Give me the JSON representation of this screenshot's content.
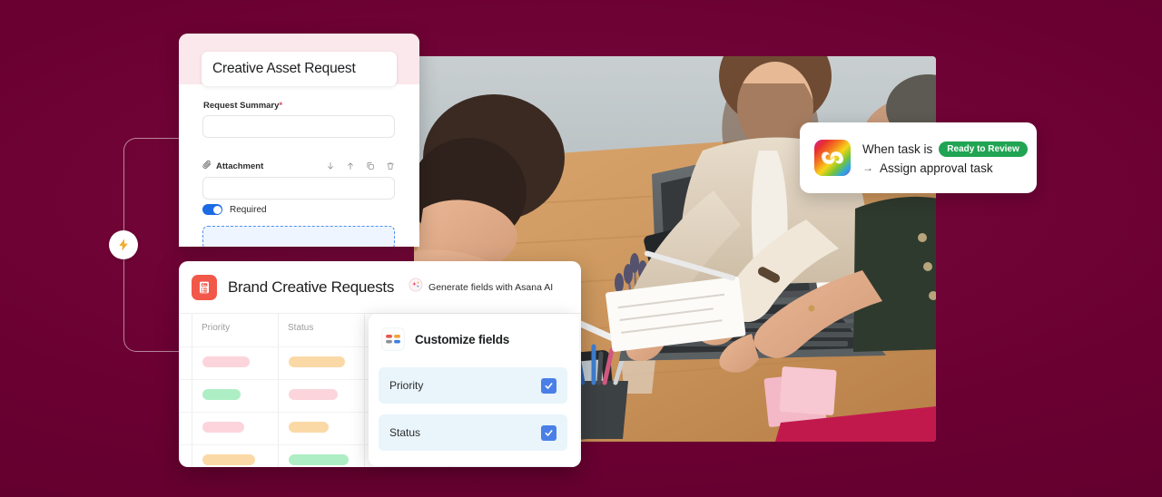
{
  "theme": {
    "background": "#6b0032",
    "accent_red": "#f2584a",
    "accent_blue": "#1d6ae5",
    "badge_green": "#21a453",
    "hero_pink": "#fbe8ec"
  },
  "connector": {
    "bolt_icon": "lightning-bolt-icon"
  },
  "form_card": {
    "title": "Creative Asset Request",
    "summary_label": "Request Summary",
    "summary_required_marker": "*",
    "summary_value": "",
    "summary_placeholder": "",
    "attachment_label": "Attachment",
    "attachment_icon": "paperclip-icon",
    "attachment_value": "",
    "attachment_placeholder": "",
    "row_actions": [
      {
        "name": "move-down-icon",
        "glyph": "↓"
      },
      {
        "name": "move-up-icon",
        "glyph": "↑"
      },
      {
        "name": "duplicate-icon",
        "glyph": "⧉"
      },
      {
        "name": "delete-icon",
        "glyph": "Ὕ1"
      }
    ],
    "required_toggle_label": "Required",
    "required_toggle_on": true,
    "dropzone_label": ""
  },
  "brand_card": {
    "app_icon": "form-document-icon",
    "title": "Brand Creative Requests",
    "ai_action": {
      "icon": "ai-sparkle-icon",
      "label": "Generate fields with Asana AI"
    },
    "table": {
      "columns": [
        "Priority",
        "Status"
      ],
      "rows": [
        {
          "priority_color": "#fbd5db",
          "status_color": "#fbd9a6"
        },
        {
          "priority_color": "#aeeec4",
          "status_color": "#fbd5db"
        },
        {
          "priority_color": "#fbd5db",
          "status_color": "#fbd9a6"
        },
        {
          "priority_color": "#fbd9a6",
          "status_color": "#aeeec4"
        }
      ]
    }
  },
  "customize_fields": {
    "icon": "field-grid-icon",
    "title": "Customize fields",
    "fields": [
      {
        "label": "Priority",
        "checked": true
      },
      {
        "label": "Status",
        "checked": true
      }
    ],
    "check_glyph": "✓"
  },
  "automation_card": {
    "app_icon": "adobe-creative-cloud-icon",
    "trigger_text": "When task is",
    "trigger_status": "Ready to Review",
    "arrow_glyph": "→",
    "action_text": "Assign approval task"
  },
  "photo": {
    "alt": "team collaborating at a wooden desk with laptops and sketches"
  }
}
